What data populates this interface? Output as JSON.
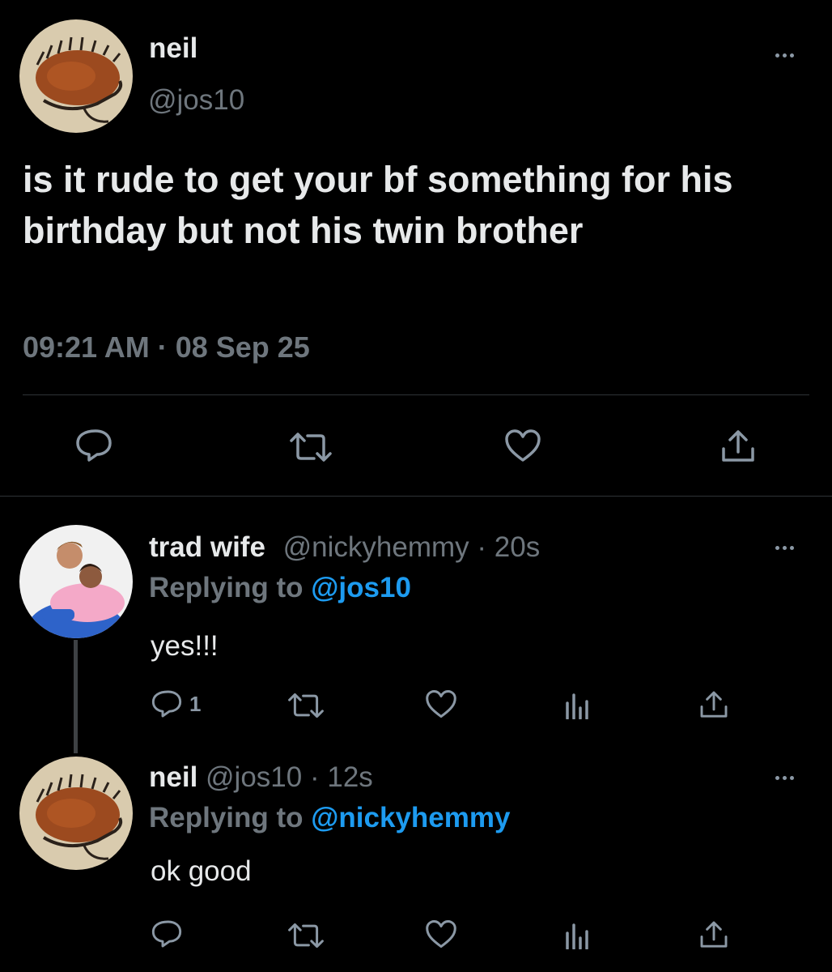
{
  "main_tweet": {
    "display_name": "neil",
    "handle": "@jos10",
    "text": "is it rude to get your bf something for his birthday but not his twin brother",
    "timestamp": "09:21 AM · 08 Sep 25",
    "avatar_icon": "hedgehog-cave-painting"
  },
  "replies": [
    {
      "display_name": "trad wife",
      "handle": "@nickyhemmy",
      "time": "· 20s",
      "replying_prefix": "Replying to",
      "replying_to": "@jos10",
      "text": "yes!!!",
      "reply_count": "1",
      "avatar_icon": "couple-photo"
    },
    {
      "display_name": "neil",
      "handle": "@jos10",
      "time": "· 12s",
      "replying_prefix": "Replying to",
      "replying_to": "@nickyhemmy",
      "text": "ok good",
      "reply_count": "",
      "avatar_icon": "hedgehog-cave-painting"
    }
  ],
  "colors": {
    "background": "#000000",
    "text": "#e7e9ea",
    "muted": "#6e767d",
    "accent": "#1d9bf0"
  },
  "icons": [
    "reply-icon",
    "retweet-icon",
    "like-icon",
    "views-icon",
    "share-icon",
    "more-icon"
  ]
}
